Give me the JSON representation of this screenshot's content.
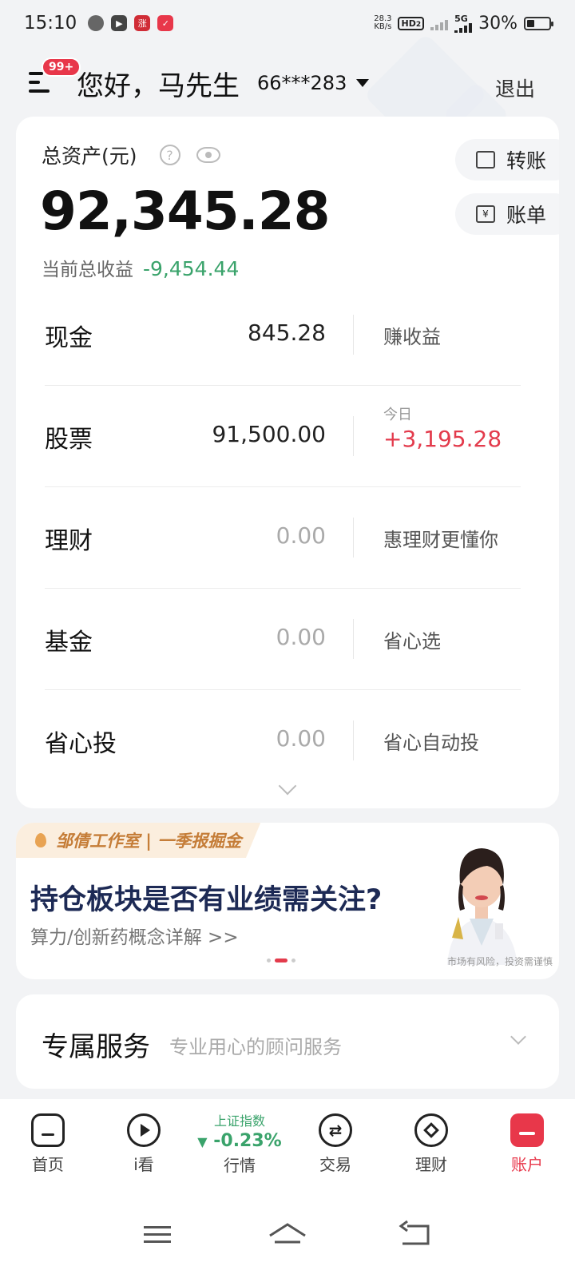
{
  "status_bar": {
    "time": "15:10",
    "speed": "28.3",
    "speed_unit": "KB/s",
    "hd": "HD",
    "hd_sub": "2",
    "network": "5G",
    "battery": "30%"
  },
  "header": {
    "badge": "99+",
    "greeting": "您好，马先生",
    "account_no": "66***283",
    "logout": "退出"
  },
  "assets": {
    "total_label": "总资产(元)",
    "total_value": "92,345.28",
    "profit_label": "当前总收益",
    "profit_value": "-9,454.44",
    "transfer_label": "转账",
    "bill_label": "账单",
    "rows": [
      {
        "name": "现金",
        "value": "845.28",
        "side": "赚收益"
      },
      {
        "name": "股票",
        "value": "91,500.00",
        "side_small": "今日",
        "side_up": "+3,195.28"
      },
      {
        "name": "理财",
        "value": "0.00",
        "side": "惠理财更懂你"
      },
      {
        "name": "基金",
        "value": "0.00",
        "side": "省心选"
      },
      {
        "name": "省心投",
        "value": "0.00",
        "side": "省心自动投"
      }
    ]
  },
  "banner": {
    "tag": "邹倩工作室 | 一季报掘金",
    "title": "持仓板块是否有业绩需关注?",
    "subtitle": "算力/创新药概念详解 >>",
    "risk_note": "市场有风险，投资需谨慎"
  },
  "service": {
    "title": "专属服务",
    "subtitle": "专业用心的顾问服务"
  },
  "tabbar": {
    "home": "首页",
    "watch": "i看",
    "market_index_name": "上证指数",
    "market_index_value": "-0.23%",
    "market": "行情",
    "trade": "交易",
    "finance": "理财",
    "account": "账户"
  },
  "colors": {
    "accent_red": "#e8374a",
    "gain_red": "#e33b4c",
    "loss_green": "#3aa36b",
    "banner_tag": "#c57d38",
    "banner_title": "#1d2a55"
  }
}
